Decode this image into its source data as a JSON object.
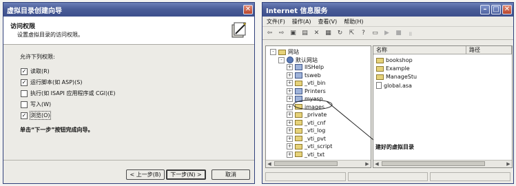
{
  "wizard": {
    "title": "虚拟目录创建向导",
    "close_glyph": "✕",
    "heading": "访问权限",
    "subheading": "设置虚拟目录的访问权限。",
    "icon": "wizard-wand-icon",
    "permissions_label": "允许下列权限:",
    "permissions": [
      {
        "label": "读取(R)",
        "checked": true
      },
      {
        "label": "运行脚本(如 ASP)(S)",
        "checked": true
      },
      {
        "label": "执行(如 ISAPI 应用程序或 CGI)(E)",
        "checked": false
      },
      {
        "label": "写入(W)",
        "checked": false
      },
      {
        "label": "浏览(O)",
        "checked": true
      }
    ],
    "finish_note": "单击“下一步”按钮完成向导。",
    "buttons": {
      "back": "< 上一步(B)",
      "next": "下一步(N) >",
      "cancel": "取消"
    }
  },
  "iis": {
    "title": "Internet 信息服务",
    "controls": {
      "minimize": "–",
      "maximize": "□",
      "close": "✕"
    },
    "menu": [
      "文件(F)",
      "操作(A)",
      "查看(V)",
      "帮助(H)"
    ],
    "toolbar_icons": [
      "back-arrow-icon",
      "forward-arrow-icon",
      "up-folder-icon",
      "show-tree-icon",
      "delete-icon",
      "properties-icon",
      "refresh-icon",
      "export-icon",
      "help-icon",
      "console-icon",
      "play-icon",
      "stop-icon",
      "pause-icon"
    ],
    "tree": [
      {
        "label": "网站",
        "level": 0,
        "type": "folder",
        "expander": "-"
      },
      {
        "label": "默认网站",
        "level": 1,
        "type": "globe",
        "expander": "-"
      },
      {
        "label": "IISHelp",
        "level": 2,
        "type": "web",
        "expander": "+"
      },
      {
        "label": "tsweb",
        "level": 2,
        "type": "web",
        "expander": "+"
      },
      {
        "label": "_vti_bin",
        "level": 2,
        "type": "folder",
        "expander": "+"
      },
      {
        "label": "Printers",
        "level": 2,
        "type": "web",
        "expander": "+"
      },
      {
        "label": "myasp",
        "level": 2,
        "type": "web",
        "expander": "+",
        "highlighted": true
      },
      {
        "label": "images",
        "level": 2,
        "type": "folder",
        "expander": "+"
      },
      {
        "label": "_private",
        "level": 2,
        "type": "folder",
        "expander": "+"
      },
      {
        "label": "_vti_cnf",
        "level": 2,
        "type": "folder",
        "expander": "+"
      },
      {
        "label": "_vti_log",
        "level": 2,
        "type": "folder",
        "expander": "+"
      },
      {
        "label": "_vti_pvt",
        "level": 2,
        "type": "folder",
        "expander": "+"
      },
      {
        "label": "_vti_script",
        "level": 2,
        "type": "folder",
        "expander": "+"
      },
      {
        "label": "_vti_txt",
        "level": 2,
        "type": "folder",
        "expander": "+"
      }
    ],
    "list": {
      "columns": [
        "名称",
        "路径"
      ],
      "items": [
        {
          "name": "bookshop",
          "type": "folder"
        },
        {
          "name": "Example",
          "type": "folder"
        },
        {
          "name": "ManageStu",
          "type": "folder"
        },
        {
          "name": "global.asa",
          "type": "file"
        }
      ]
    },
    "annotation": "建好的虚拟目录"
  }
}
